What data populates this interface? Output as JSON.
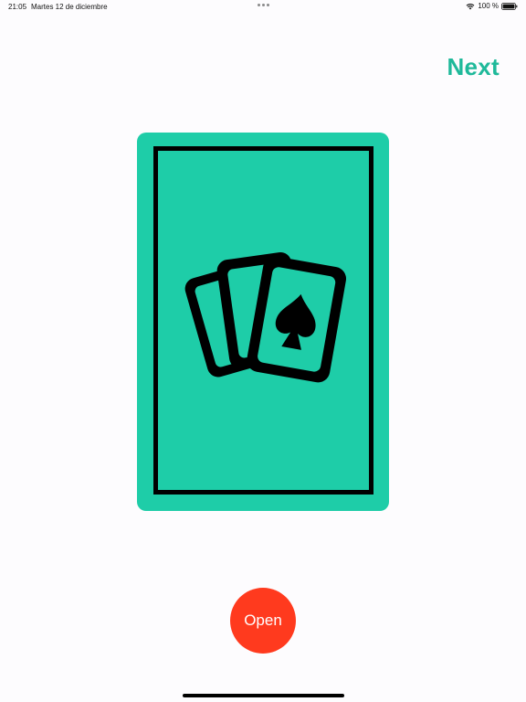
{
  "status_bar": {
    "time": "21:05",
    "date": "Martes 12 de diciembre",
    "battery": "100 %",
    "icons": [
      "wifi-icon",
      "battery-icon"
    ]
  },
  "header": {
    "next_label": "Next"
  },
  "card": {
    "icon": "playing-cards-spade-icon",
    "color": "#1ecda8"
  },
  "actions": {
    "open_label": "Open"
  },
  "colors": {
    "accent": "#1fb99a",
    "open_button": "#ff3a1e",
    "background": "#fdfcfe"
  }
}
